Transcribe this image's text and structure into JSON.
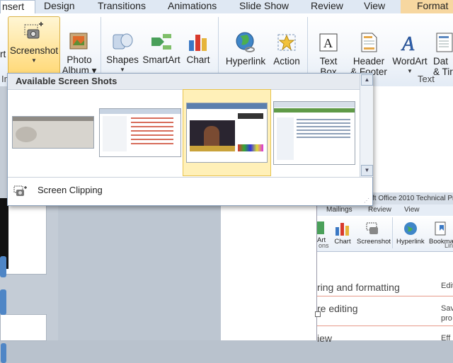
{
  "tabs": [
    {
      "id": "insert",
      "label": "nsert"
    },
    {
      "id": "design",
      "label": "Design"
    },
    {
      "id": "transitions",
      "label": "Transitions"
    },
    {
      "id": "animations",
      "label": "Animations"
    },
    {
      "id": "slideshow",
      "label": "Slide Show"
    },
    {
      "id": "review",
      "label": "Review"
    },
    {
      "id": "view",
      "label": "View"
    },
    {
      "id": "format",
      "label": "Format"
    }
  ],
  "ribbon": {
    "screenshot": {
      "label": "Screenshot",
      "cut_prefix": "rt",
      "arrow": "▼"
    },
    "photo_album": {
      "line1": "Photo",
      "line2": "Album ▾"
    },
    "shapes": {
      "label": "Shapes"
    },
    "smartart": {
      "label": "SmartArt"
    },
    "chart": {
      "label": "Chart"
    },
    "hyperlink": {
      "label": "Hyperlink"
    },
    "action": {
      "label": "Action"
    },
    "text_box": {
      "line1": "Text",
      "line2": "Box"
    },
    "header_footer": {
      "line1": "Header",
      "line2": "& Footer"
    },
    "wordart": {
      "label": "WordArt"
    },
    "date_time": {
      "line1": "Dat",
      "line2": "& Tir"
    },
    "group_labels": {
      "images": "Im",
      "text": "Text"
    }
  },
  "gallery": {
    "heading": "Available Screen Shots",
    "screen_clipping": "Screen Clipping",
    "shots": [
      "shot-1",
      "shot-2",
      "shot-3",
      "shot-4"
    ]
  },
  "word_window": {
    "title": "ft Office 2010 Technical Pre",
    "tabs": {
      "mailings": "Mailings",
      "review": "Review",
      "view": "View"
    },
    "buttons": {
      "smartart": "Art",
      "chart": "Chart",
      "screenshot": "Screenshot",
      "hyperlink": "Hyperlink",
      "bookmark": "Bookma"
    },
    "groups": {
      "illustrations": "ons",
      "links": "Lin"
    },
    "lines": [
      {
        "text": "ring and formatting",
        "right": "Edit"
      },
      {
        "text": "re editing",
        "right": "Sav",
        "right2": "pro"
      },
      {
        "text": "iew",
        "right": "Eff"
      }
    ]
  },
  "colors": {
    "accent": "#ffd978",
    "ribbon": "#dfe8f3",
    "format_tab": "#f7d7a0"
  }
}
